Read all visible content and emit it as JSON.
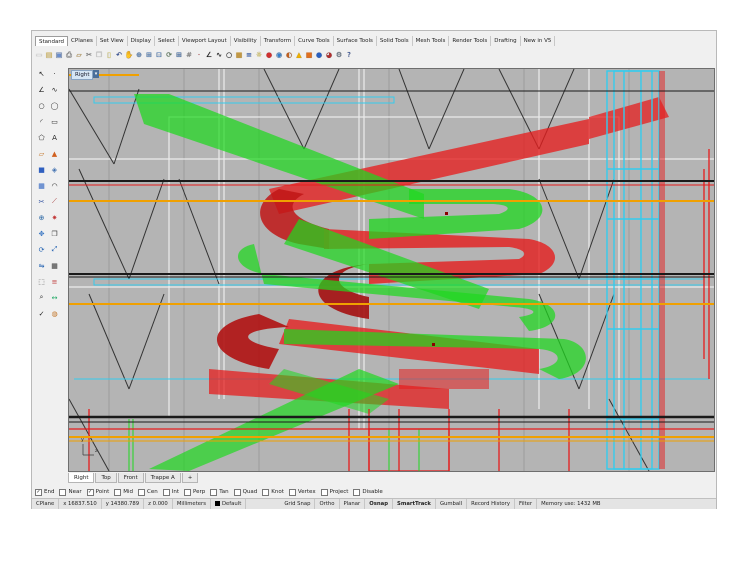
{
  "tabs": [
    "Standard",
    "CPlanes",
    "Set View",
    "Display",
    "Select",
    "Viewport Layout",
    "Visibility",
    "Transform",
    "Curve Tools",
    "Surface Tools",
    "Solid Tools",
    "Mesh Tools",
    "Render Tools",
    "Drafting",
    "New in V5"
  ],
  "viewport": {
    "title": "Right",
    "menu_glyph": "▾"
  },
  "axis": {
    "x": "z",
    "y": "y"
  },
  "viewport_tabs": [
    "Right",
    "Top",
    "Front",
    "Trappe A",
    "+"
  ],
  "osnaps": [
    {
      "label": "End",
      "checked": "✓"
    },
    {
      "label": "Near",
      "checked": ""
    },
    {
      "label": "Point",
      "checked": "✓"
    },
    {
      "label": "Mid",
      "checked": ""
    },
    {
      "label": "Cen",
      "checked": ""
    },
    {
      "label": "Int",
      "checked": ""
    },
    {
      "label": "Perp",
      "checked": ""
    },
    {
      "label": "Tan",
      "checked": ""
    },
    {
      "label": "Quad",
      "checked": ""
    },
    {
      "label": "Knot",
      "checked": ""
    },
    {
      "label": "Vertex",
      "checked": ""
    },
    {
      "label": "Project",
      "checked": ""
    },
    {
      "label": "Disable",
      "checked": ""
    }
  ],
  "status": {
    "cplane": "CPlane",
    "x": "x 16837.510",
    "y": "y 14380.789",
    "z": "z 0.000",
    "units": "Millimeters",
    "layer": "Default",
    "grid_snap": "Grid Snap",
    "ortho": "Ortho",
    "planar": "Planar",
    "osnap": "Osnap",
    "smarttrack": "SmartTrack",
    "gumball": "Gumball",
    "record_history": "Record History",
    "filter": "Filter",
    "memory": "Memory use: 1432 MB"
  },
  "toolbar_icons": [
    "new-icon",
    "open-icon",
    "save-icon",
    "print-icon",
    "import-icon",
    "cut-icon",
    "copy-icon",
    "paste-icon",
    "undo-icon",
    "pan-icon",
    "zoom-window-icon",
    "zoom-extents-icon",
    "zoom-selected-icon",
    "rotate-view-icon",
    "viewport-4-icon",
    "grid-icon",
    "point-icon",
    "polyline-icon",
    "curve-icon",
    "circle-icon",
    "properties-icon",
    "layer-icon",
    "light-icon",
    "render-icon",
    "render-sphere-icon",
    "material-icon",
    "extrude-icon",
    "box-icon",
    "sphere-icon",
    "color-icon",
    "options-icon",
    "help-icon"
  ],
  "sidebar_icons": [
    "select-icon",
    "point-icon",
    "polyline-icon",
    "curve-icon",
    "circle-icon",
    "ellipse-icon",
    "arc-icon",
    "rectangle-icon",
    "polygon-icon",
    "text-icon",
    "surface-icon",
    "extrude-icon",
    "solid-box-icon",
    "boolean-icon",
    "mesh-icon",
    "fillet-icon",
    "trim-icon",
    "split-icon",
    "join-icon",
    "explode-icon",
    "move-icon",
    "copy-icon",
    "rotate-icon",
    "scale-icon",
    "mirror-icon",
    "array-icon",
    "group-icon",
    "layer-icon",
    "analyze-icon",
    "dimension-icon",
    "check-icon",
    "render-icon"
  ],
  "colors": {
    "viewport_bg": "#b4b4b4",
    "green_ramp": "#1fd81f",
    "red_ramp": "#e51d1d",
    "cyan": "#33ccee",
    "orange": "#f0a000",
    "dark_line": "#1a1a1a"
  }
}
